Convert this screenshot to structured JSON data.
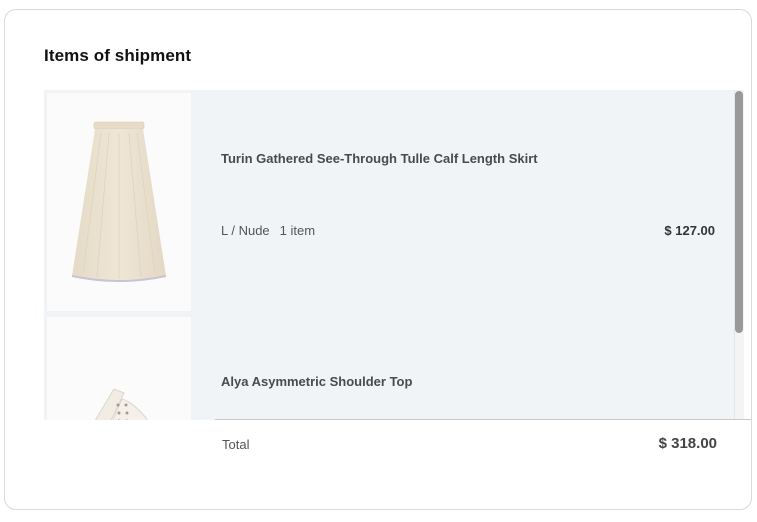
{
  "title": "Items of shipment",
  "items": [
    {
      "name": "Turin Gathered See-Through Tulle Calf Length Skirt",
      "variant": "L / Nude",
      "quantity": "1 item",
      "price": "$ 127.00",
      "image_icon": "skirt-image"
    },
    {
      "name": "Alya Asymmetric Shoulder Top",
      "image_icon": "top-image"
    }
  ],
  "total": {
    "label": "Total",
    "value": "$ 318.00"
  },
  "colors": {
    "item_background": "#f0f4f7",
    "scrollbar_thumb": "#999999",
    "skirt_color": "#ede3d2"
  }
}
